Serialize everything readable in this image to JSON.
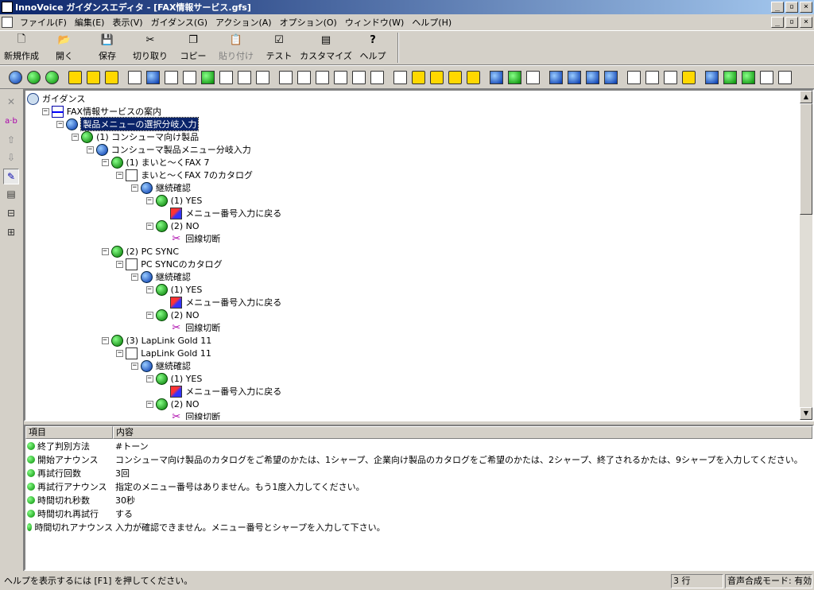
{
  "window": {
    "title": "InnoVoice ガイダンスエディタ - [FAX情報サービス.gfs]"
  },
  "caption_buttons": [
    "_",
    "▫",
    "×"
  ],
  "menu": [
    "ファイル(F)",
    "編集(E)",
    "表示(V)",
    "ガイダンス(G)",
    "アクション(A)",
    "オプション(O)",
    "ウィンドウ(W)",
    "ヘルプ(H)"
  ],
  "toolbar_main": [
    {
      "label": "新規作成",
      "icon": "new-doc-icon",
      "glyph": "🗋"
    },
    {
      "label": "開く",
      "icon": "open-folder-icon",
      "glyph": "📂"
    },
    {
      "label": "保存",
      "icon": "save-disk-icon",
      "glyph": "💾"
    },
    {
      "label": "切り取り",
      "icon": "scissors-icon",
      "glyph": "✂"
    },
    {
      "label": "コピー",
      "icon": "copy-icon",
      "glyph": "❐"
    },
    {
      "label": "貼り付け",
      "icon": "paste-icon",
      "glyph": "📋"
    },
    {
      "label": "テスト",
      "icon": "test-check-icon",
      "glyph": "☑"
    },
    {
      "label": "カスタマイズ",
      "icon": "customize-icon",
      "glyph": "▤"
    },
    {
      "label": "ヘルプ",
      "icon": "help-icon",
      "glyph": "?"
    }
  ],
  "tree": {
    "rows": [
      {
        "text": "ガイダンス",
        "kind": "guid"
      },
      {
        "text": "FAX情報サービスの案内",
        "kind": "root"
      },
      {
        "text": "製品メニューの選択分岐入力",
        "kind": "blue",
        "selected": true
      },
      {
        "text": "(1) コンシューマ向け製品",
        "kind": "green"
      },
      {
        "text": "コンシューマ製品メニュー分岐入力",
        "kind": "blue"
      },
      {
        "text": "(1) まいと～くFAX 7",
        "kind": "green"
      },
      {
        "text": "まいと～くFAX 7のカタログ",
        "kind": "doc"
      },
      {
        "text": "継続確認",
        "kind": "blue"
      },
      {
        "text": "(1) YES",
        "kind": "green"
      },
      {
        "text": "メニュー番号入力に戻る",
        "kind": "back"
      },
      {
        "text": "(2) NO",
        "kind": "green"
      },
      {
        "text": "回線切断",
        "kind": "cut"
      },
      {
        "text": "(2) PC SYNC",
        "kind": "green"
      },
      {
        "text": "PC SYNCのカタログ",
        "kind": "doc"
      },
      {
        "text": "継続確認",
        "kind": "blue"
      },
      {
        "text": "(1) YES",
        "kind": "green"
      },
      {
        "text": "メニュー番号入力に戻る",
        "kind": "back"
      },
      {
        "text": "(2) NO",
        "kind": "green"
      },
      {
        "text": "回線切断",
        "kind": "cut"
      },
      {
        "text": "(3) LapLink Gold 11",
        "kind": "green"
      },
      {
        "text": "LapLink Gold 11",
        "kind": "doc"
      },
      {
        "text": "継続確認",
        "kind": "blue"
      },
      {
        "text": "(1) YES",
        "kind": "green"
      },
      {
        "text": "メニュー番号入力に戻る",
        "kind": "back"
      },
      {
        "text": "(2) NO",
        "kind": "green"
      },
      {
        "text": "回線切断",
        "kind": "cut"
      }
    ]
  },
  "properties": {
    "header_item": "項目",
    "header_content": "内容",
    "rows": [
      {
        "key": "終了判別方法",
        "value": "#トーン"
      },
      {
        "key": "開始アナウンス",
        "value": "コンシューマ向け製品のカタログをご希望のかたは、1シャープ、企業向け製品のカタログをご希望のかたは、2シャープ、終了されるかたは、9シャープを入力してください。"
      },
      {
        "key": "再試行回数",
        "value": "3回"
      },
      {
        "key": "再試行アナウンス",
        "value": "指定のメニュー番号はありません。もう1度入力してください。"
      },
      {
        "key": "時間切れ秒数",
        "value": "30秒"
      },
      {
        "key": "時間切れ再試行",
        "value": "する"
      },
      {
        "key": "時間切れアナウンス",
        "value": "入力が確認できません。メニュー番号とシャープを入力して下さい。"
      }
    ]
  },
  "status": {
    "help": "ヘルプを表示するには [F1] を押してください。",
    "rows": "3 行",
    "tts": "音声合成モード: 有効"
  }
}
